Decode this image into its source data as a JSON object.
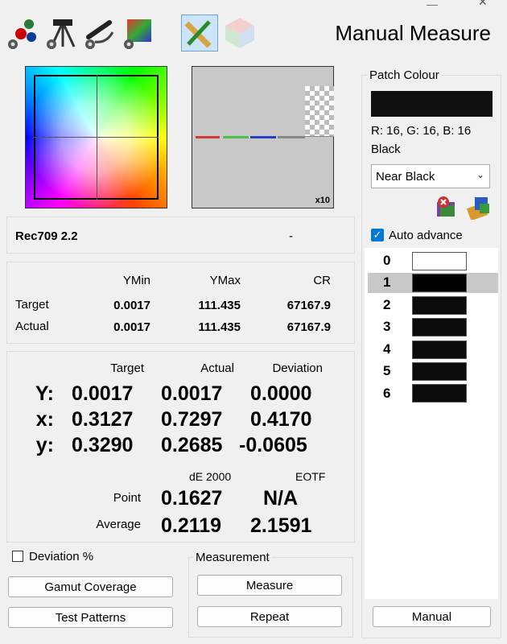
{
  "window": {
    "title": "Manual Measure"
  },
  "toolbar": {
    "icons": [
      "colors-settings-icon",
      "meter-settings-icon",
      "connection-settings-icon",
      "display-settings-icon",
      "manual-measure-icon",
      "cube-icon"
    ]
  },
  "preview": {
    "zoom": "x10"
  },
  "profile": {
    "name": "Rec709 2.2",
    "status": "-"
  },
  "luminance": {
    "headers": [
      "YMin",
      "YMax",
      "CR"
    ],
    "rows": [
      {
        "label": "Target",
        "ymin": "0.0017",
        "ymax": "111.435",
        "cr": "67167.9"
      },
      {
        "label": "Actual",
        "ymin": "0.0017",
        "ymax": "111.435",
        "cr": "67167.9"
      }
    ]
  },
  "measure": {
    "headers": [
      "Target",
      "Actual",
      "Deviation"
    ],
    "rows": [
      {
        "label": "Y:",
        "target": "0.0017",
        "actual": "0.0017",
        "deviation": "0.0000"
      },
      {
        "label": "x:",
        "target": "0.3127",
        "actual": "0.7297",
        "deviation": "0.4170"
      },
      {
        "label": "y:",
        "target": "0.3290",
        "actual": "0.2685",
        "deviation": "-0.0605"
      }
    ],
    "de_header": "dE 2000",
    "eotf_header": "EOTF",
    "point": {
      "label": "Point",
      "de": "0.1627",
      "eotf": "N/A"
    },
    "average": {
      "label": "Average",
      "de": "0.2119",
      "eotf": "2.1591"
    }
  },
  "options": {
    "deviation_percent": "Deviation %",
    "deviation_checked": false
  },
  "buttons": {
    "gamut": "Gamut Coverage",
    "patterns": "Test Patterns",
    "measurement_group": "Measurement",
    "measure": "Measure",
    "repeat": "Repeat",
    "manual": "Manual"
  },
  "patch": {
    "group_label": "Patch Colour",
    "rgb": "R: 16, G: 16, B: 16",
    "name": "Black",
    "color": "#101010",
    "selected": "Near Black",
    "auto_advance": "Auto advance",
    "auto_advance_checked": true,
    "list": [
      {
        "index": "0",
        "color": "#ffffff"
      },
      {
        "index": "1",
        "color": "#000000"
      },
      {
        "index": "2",
        "color": "#0c0c0c"
      },
      {
        "index": "3",
        "color": "#0c0c0c"
      },
      {
        "index": "4",
        "color": "#0c0c0c"
      },
      {
        "index": "5",
        "color": "#0c0c0c"
      },
      {
        "index": "6",
        "color": "#0c0c0c"
      }
    ],
    "selected_index": "1"
  },
  "colors": {
    "accent": "#0078d7",
    "selection": "#c8c8c8"
  }
}
